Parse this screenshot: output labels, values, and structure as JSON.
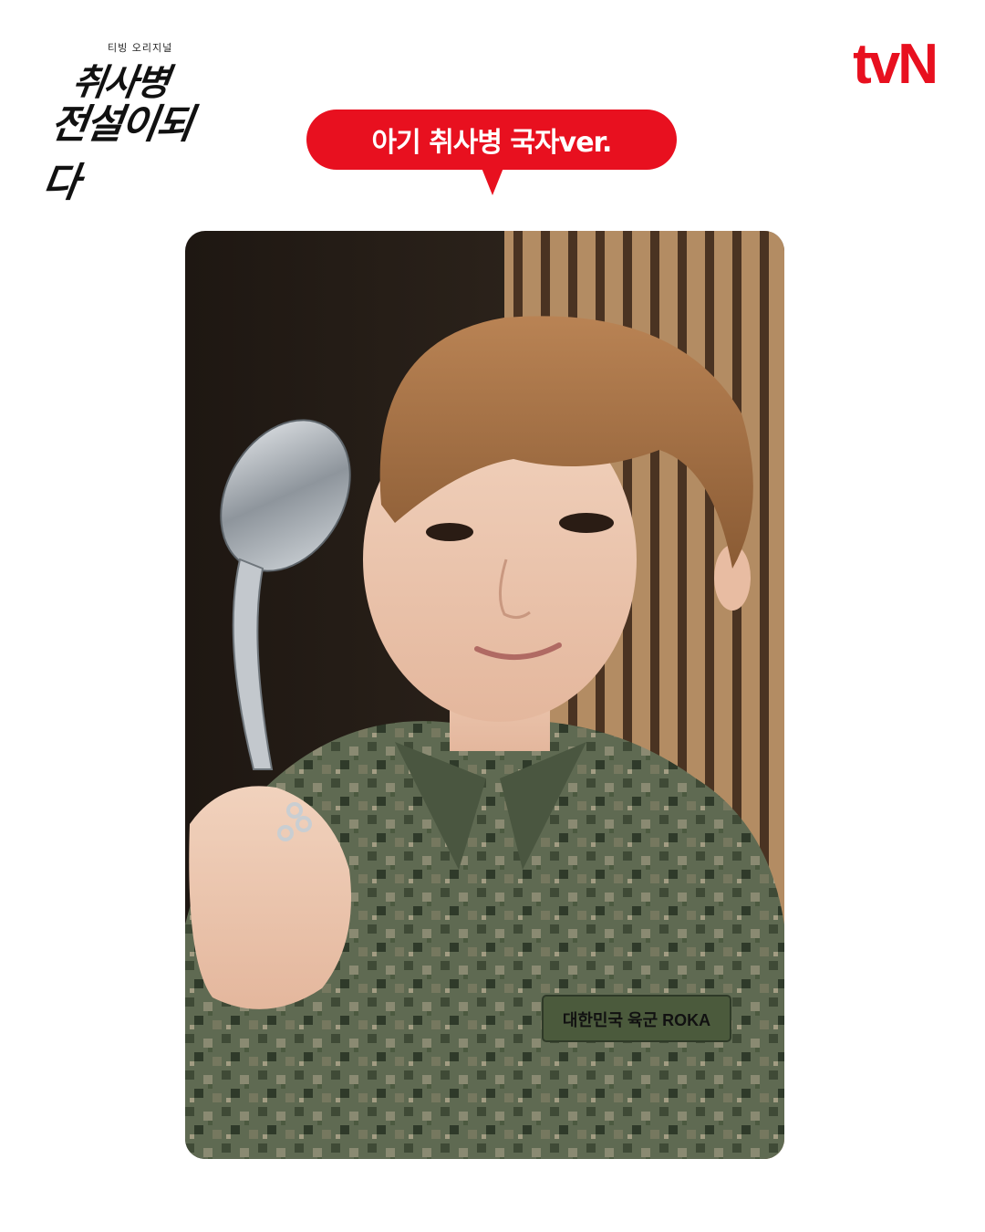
{
  "header": {
    "show_logo": {
      "subtitle": "티빙 오리지널",
      "line1": "취사병",
      "line2": "전설이되다"
    },
    "channel_logo": "tvN"
  },
  "caption": {
    "text": "아기 취사병 국자ver."
  },
  "photo": {
    "patch_text": "대한민국 육군 ROKA"
  },
  "colors": {
    "accent": "#e8101f",
    "background": "#ffffff"
  }
}
